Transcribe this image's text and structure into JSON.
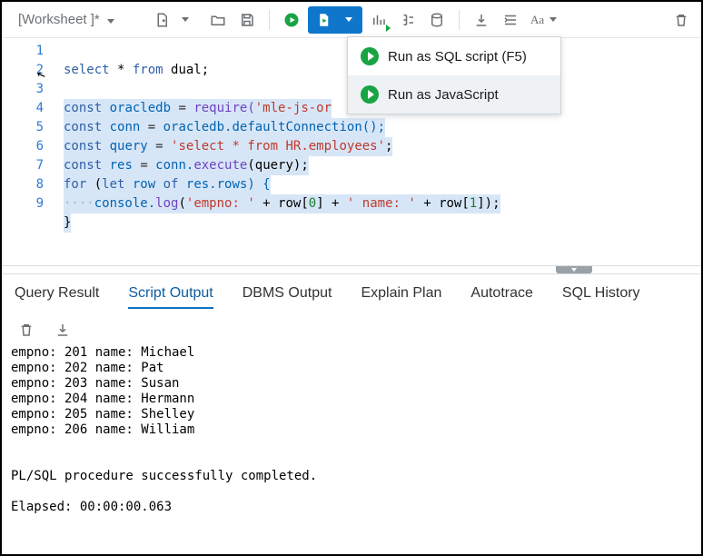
{
  "worksheet_title": "[Worksheet ]*",
  "dropdown": {
    "items": [
      {
        "label": "Run as SQL script (F5)"
      },
      {
        "label": "Run as JavaScript"
      }
    ]
  },
  "editor": {
    "lines": [
      1,
      2,
      3,
      4,
      5,
      6,
      7,
      8,
      9
    ],
    "code": {
      "l1_select": "select",
      "l1_rest": " * ",
      "l1_from": "from",
      "l1_end": " dual;",
      "l3_a": "const",
      "l3_b": " oracledb ",
      "l3_eq": "=",
      "l3_c": " require(",
      "l3_str": "'mle-js-or",
      "l4_a": "const",
      "l4_b": " conn ",
      "l4_eq": "=",
      "l4_c": " oracledb.default",
      "l4_d": "Connection();",
      "l5_a": "const",
      "l5_b": " query ",
      "l5_eq": "=",
      "l5_str": " 'select * from HR.employees'",
      "l5_end": ";",
      "l6_a": "const",
      "l6_b": " res ",
      "l6_eq": "=",
      "l6_c": " conn.",
      "l6_fn": "execute",
      "l6_d": "(query);",
      "l7_a": "for",
      "l7_b": " (",
      "l7_let": "let",
      "l7_c": " row ",
      "l7_of": "of",
      "l7_d": " res.rows) {",
      "l8_dots": "····",
      "l8_a": "console.",
      "l8_fn": "log",
      "l8_b": "(",
      "l8_s1": "'empno: '",
      "l8_p1": " + row[",
      "l8_n0": "0",
      "l8_p2": "] + ",
      "l8_s2": "' name: '",
      "l8_p3": " + row[",
      "l8_n1": "1",
      "l8_p4": "]);",
      "l9": "}"
    }
  },
  "tabs": [
    "Query Result",
    "Script Output",
    "DBMS Output",
    "Explain Plan",
    "Autotrace",
    "SQL History"
  ],
  "active_tab": 1,
  "output_lines": [
    "empno: 201 name: Michael",
    "empno: 202 name: Pat",
    "empno: 203 name: Susan",
    "empno: 204 name: Hermann",
    "empno: 205 name: Shelley",
    "empno: 206 name: William",
    "",
    "",
    "PL/SQL procedure successfully completed.",
    "",
    "Elapsed: 00:00:00.063"
  ]
}
